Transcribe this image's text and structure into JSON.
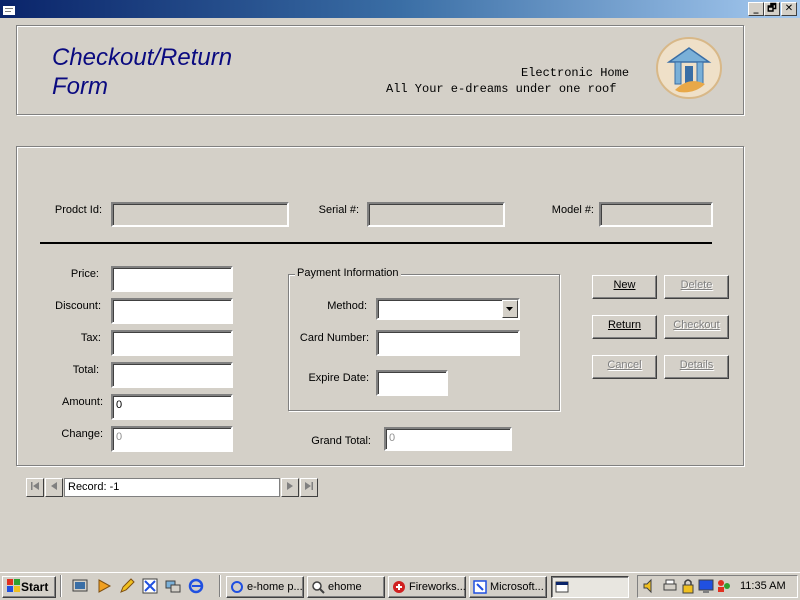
{
  "window": {
    "close_glyph": "✕",
    "restore_glyph": "🗗",
    "minimize_glyph": "_"
  },
  "header": {
    "title_line1": "Checkout/Return",
    "title_line2": "Form",
    "company": "Electronic Home",
    "tagline": "All Your e-dreams under one roof",
    "logo_icon": "house-e-logo"
  },
  "product": {
    "product_id_label": "Prodct Id:",
    "serial_label": "Serial #:",
    "model_label": "Model #:",
    "product_id_value": "",
    "serial_value": "",
    "model_value": ""
  },
  "amounts": {
    "price_label": "Price:",
    "discount_label": "Discount:",
    "tax_label": "Tax:",
    "total_label": "Total:",
    "amount_label": "Amount:",
    "change_label": "Change:",
    "price_value": "",
    "discount_value": "",
    "tax_value": "",
    "total_value": "",
    "amount_value": "0",
    "change_value": "0"
  },
  "payment": {
    "group_label": "Payment Information",
    "method_label": "Method:",
    "card_label": "Card Number:",
    "expire_label": "Expire Date:",
    "method_value": "",
    "card_value": "",
    "expire_value": ""
  },
  "grand_total": {
    "label": "Grand Total:",
    "value": "0"
  },
  "buttons": {
    "new": "New",
    "delete": "Delete",
    "return": "Return",
    "checkout": "Checkout",
    "cancel": "Cancel",
    "details": "Details"
  },
  "record_nav": {
    "text": "Record: -1"
  },
  "taskbar": {
    "start": "Start",
    "tasks": [
      "e-home p...",
      "ehome",
      "Fireworks...",
      "Microsoft...",
      ""
    ],
    "clock": "11:35 AM"
  }
}
